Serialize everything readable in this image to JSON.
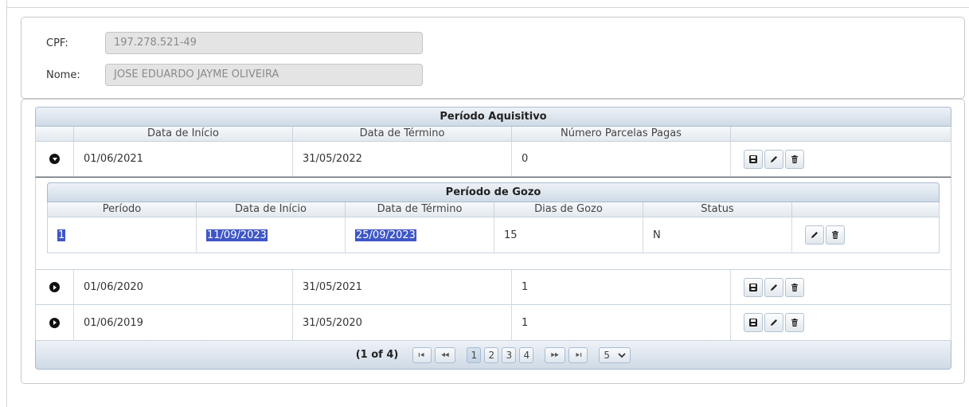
{
  "form": {
    "cpf_label": "CPF:",
    "cpf_value": "197.278.521-49",
    "nome_label": "Nome:",
    "nome_value": "JOSE EDUARDO JAYME OLIVEIRA"
  },
  "aquisitivo": {
    "title": "Período Aquisitivo",
    "columns": [
      "Data de Início",
      "Data de Término",
      "Número Parcelas Pagas"
    ],
    "rows": [
      {
        "inicio": "01/06/2021",
        "termino": "31/05/2022",
        "parcelas": "0",
        "expanded": true
      },
      {
        "inicio": "01/06/2020",
        "termino": "31/05/2021",
        "parcelas": "1",
        "expanded": false
      },
      {
        "inicio": "01/06/2019",
        "termino": "31/05/2020",
        "parcelas": "1",
        "expanded": false
      }
    ]
  },
  "gozo": {
    "title": "Período de Gozo",
    "columns": [
      "Período",
      "Data de Início",
      "Data de Término",
      "Dias de Gozo",
      "Status"
    ],
    "rows": [
      {
        "periodo": "1",
        "inicio": "11/09/2023",
        "termino": "25/09/2023",
        "dias": "15",
        "status": "N"
      }
    ]
  },
  "paginator": {
    "current": "(1 of 4)",
    "first": "⏮",
    "prev": "⏪",
    "pages": [
      "1",
      "2",
      "3",
      "4"
    ],
    "active_page": "1",
    "next": "⏩",
    "last": "⏭",
    "rows_per_page": "5"
  },
  "icons": {
    "save": "save-icon",
    "edit": "pencil-icon",
    "delete": "trash-icon",
    "expand": "chevron-right-circle-icon",
    "collapse": "chevron-down-circle-icon"
  },
  "colors": {
    "header_gradient_top": "#eef2f7",
    "header_gradient_bottom": "#cfdae6",
    "selection": "#3f56c6",
    "field_bg": "#e4e4e4"
  }
}
